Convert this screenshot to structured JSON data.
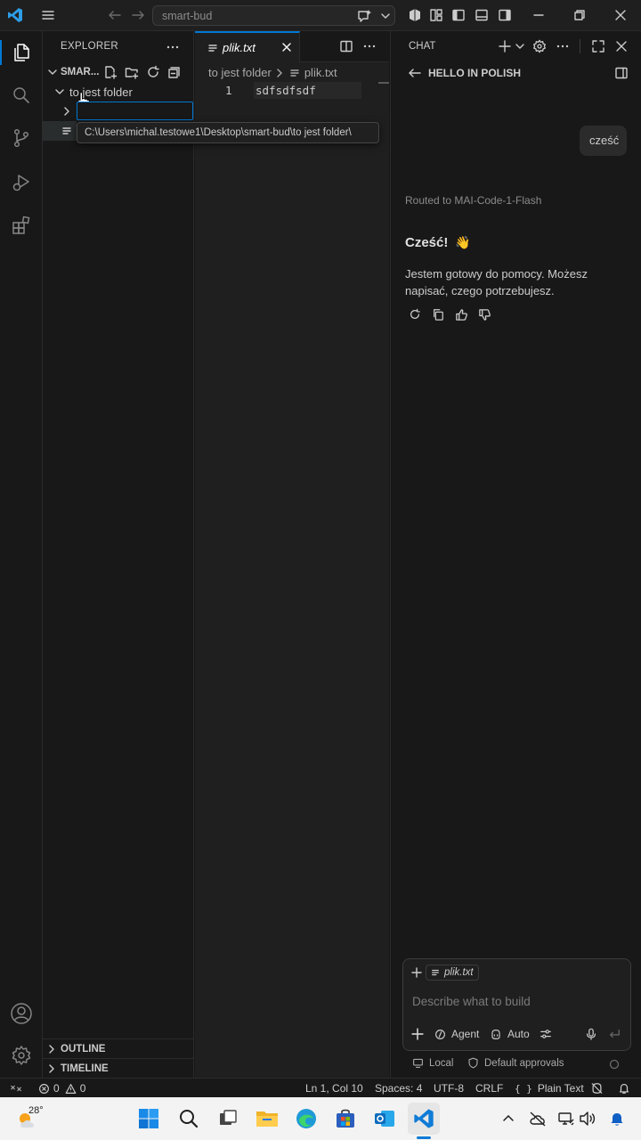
{
  "titlebar": {
    "search_text": "smart-bud"
  },
  "sidebar": {
    "title": "EXPLORER",
    "root_label": "SMAR...",
    "folder_label": "to jest folder",
    "tooltip": "C:\\Users\\michal.testowe1\\Desktop\\smart-bud\\to jest folder\\",
    "outline_label": "OUTLINE",
    "timeline_label": "TIMELINE"
  },
  "editor": {
    "tab_label": "plik.txt",
    "breadcrumb_folder": "to jest folder",
    "breadcrumb_file": "plik.txt",
    "line_number": "1",
    "line_text": "sdfsdfsdf"
  },
  "chat": {
    "title": "CHAT",
    "session_title": "HELLO IN POLISH",
    "user_message": "cześć",
    "routed_text": "Routed to MAI-Code-1-Flash",
    "reply_heading": "Cześć!",
    "reply_emoji": "👋",
    "reply_body": "Jestem gotowy do pomocy. Możesz napisać, czego potrzebujesz.",
    "attachment": "plik.txt",
    "input_placeholder": "Describe what to build",
    "mode_agent": "Agent",
    "mode_auto": "Auto",
    "footer_local": "Local",
    "footer_approvals": "Default approvals"
  },
  "statusbar": {
    "errors": "0",
    "warnings": "0",
    "position": "Ln 1, Col 10",
    "spaces": "Spaces: 4",
    "encoding": "UTF-8",
    "eol": "CRLF",
    "language": "Plain Text"
  },
  "taskbar": {
    "weather_temp": "28°"
  },
  "colors": {
    "accent": "#0078d4",
    "background": "#181818",
    "editor_bg": "#1f1f1f"
  }
}
